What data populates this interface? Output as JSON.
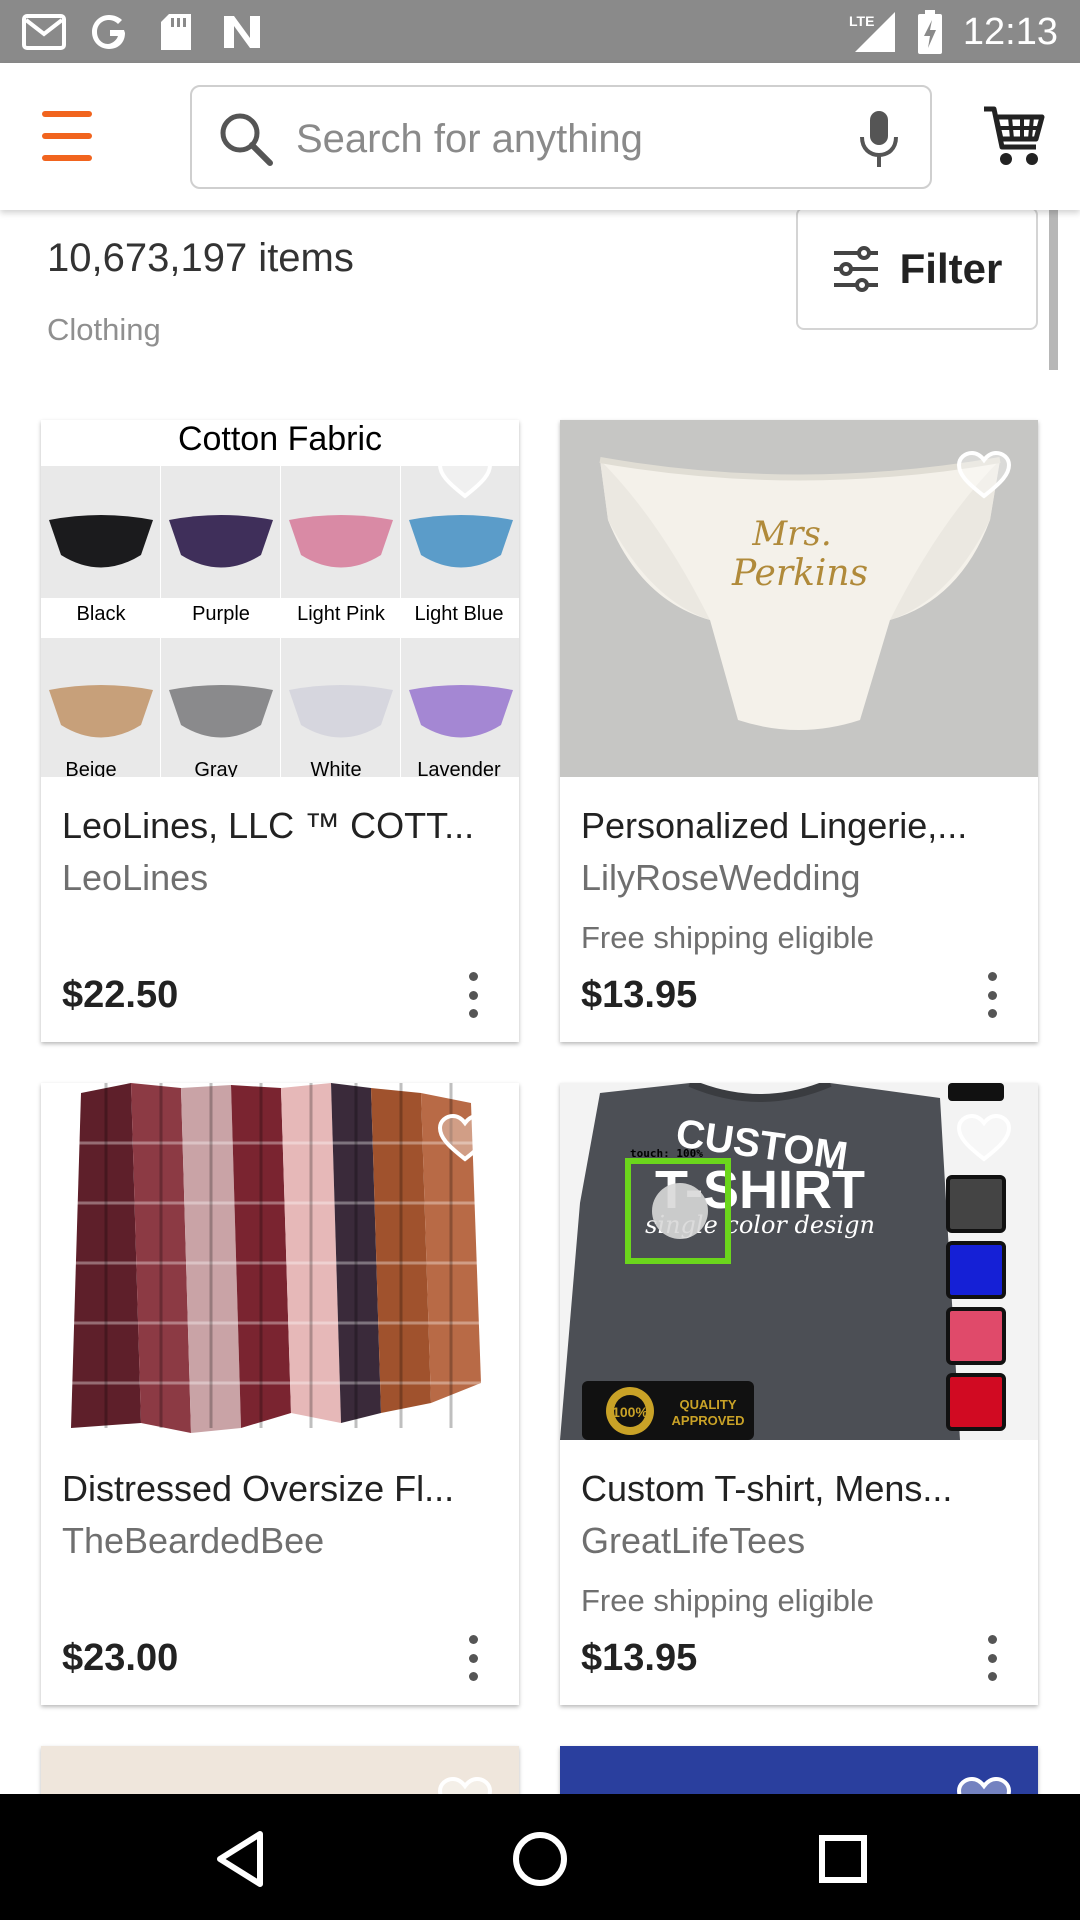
{
  "status_bar": {
    "time": "12:13",
    "network": "LTE",
    "icons": [
      "gmail-icon",
      "google-icon",
      "sd-card-icon",
      "n-app-icon",
      "signal-icon",
      "battery-icon"
    ]
  },
  "app_bar": {
    "search_placeholder": "Search for anything",
    "accent_color": "#f1641e"
  },
  "results": {
    "count": "10,673,197 items",
    "category": "Clothing",
    "filter_label": "Filter"
  },
  "cards": [
    {
      "title": "LeoLines, LLC ™ COTT...",
      "shop": "LeoLines",
      "shipping": "",
      "price": "$22.50",
      "image": {
        "heading": "Cotton Fabric",
        "swatches": [
          {
            "label": "Black",
            "color": "#1b1b1d"
          },
          {
            "label": "Purple",
            "color": "#3f2f5a"
          },
          {
            "label": "Light Pink",
            "color": "#d98aa5"
          },
          {
            "label": "Light Blue",
            "color": "#5b9cc9"
          },
          {
            "label": "Beige",
            "color": "#c7a07a"
          },
          {
            "label": "Gray",
            "color": "#8a8a8c"
          },
          {
            "label": "White",
            "color": "#e4e4ea"
          },
          {
            "label": "Lavender",
            "color": "#a487d3"
          }
        ]
      }
    },
    {
      "title": "Personalized Lingerie,...",
      "shop": "LilyRoseWedding",
      "shipping": "Free shipping eligible",
      "price": "$13.95",
      "image": {
        "text_line1": "Mrs.",
        "text_line2": "Perkins"
      }
    },
    {
      "title": "Distressed Oversize Fl...",
      "shop": "TheBeardedBee",
      "shipping": "",
      "price": "$23.00",
      "image": {}
    },
    {
      "title": "Custom T-shirt, Mens...",
      "shop": "GreatLifeTees",
      "shipping": "Free shipping eligible",
      "price": "$13.95",
      "image": {
        "line1": "CUSTOM",
        "line2": "T-SHIRT",
        "line3": "single color design",
        "badge_pct": "100%",
        "badge_line1": "QUALITY",
        "badge_line2": "APPROVED",
        "overlay_label": "touch: 100%"
      }
    }
  ]
}
